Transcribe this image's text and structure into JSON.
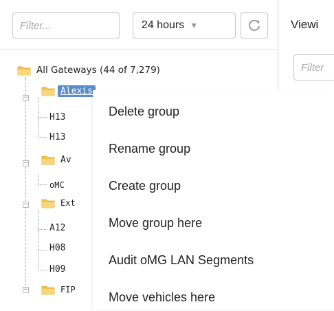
{
  "toolbar": {
    "filter_placeholder": "Filter...",
    "period_value": "24 hours",
    "period_chevron": "▼"
  },
  "tree": {
    "root_label": "All Gateways (44 of 7,279)",
    "rows": [
      {
        "label": "Alexis",
        "selected": true
      },
      {
        "label": "H13"
      },
      {
        "label": "H13"
      },
      {
        "label": "Av"
      },
      {
        "label": "oMC"
      },
      {
        "label": "Ext"
      },
      {
        "label": "A12"
      },
      {
        "label": "H08"
      },
      {
        "label": "H09"
      },
      {
        "label": "FIP"
      }
    ]
  },
  "right_panel": {
    "viewing_label": "Viewi",
    "filter_placeholder": "Filter"
  },
  "context_menu": {
    "items": [
      "Delete group",
      "Rename group",
      "Create group",
      "Move group here",
      "Audit oMG LAN Segments",
      "Move vehicles here"
    ]
  },
  "colors": {
    "selection": "#5b8bc9",
    "folder": "#f2c14e",
    "border": "#c9c9c9"
  }
}
